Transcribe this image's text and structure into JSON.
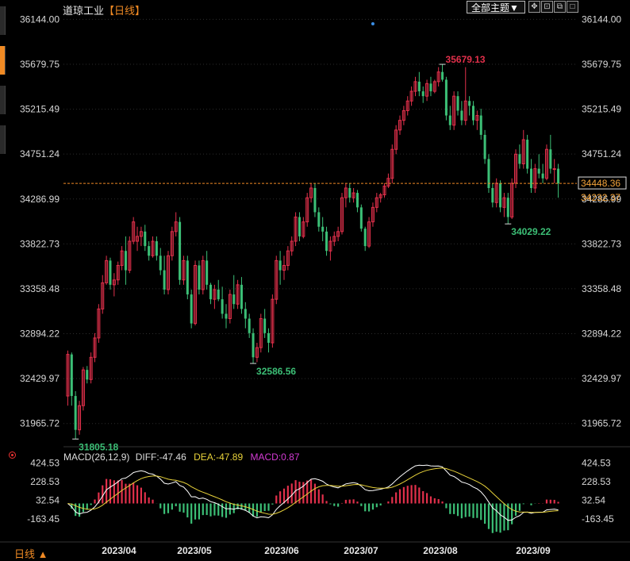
{
  "window": {
    "left_tabs": 4,
    "active_tab": 1
  },
  "title": {
    "name": "道琼工业",
    "period": "【日线】"
  },
  "toolbar": {
    "theme_label": "全部主题▼",
    "icons": [
      "move-icon",
      "zoom-fit-icon",
      "restore-icon",
      "maximize-icon"
    ]
  },
  "bottom": {
    "period_tab": "日线 ▲"
  },
  "colors": {
    "up": "#e2304b",
    "down": "#3cbf76",
    "diff": "#ffffff",
    "dea": "#e8d23a",
    "macd": "#d43bd4",
    "grid": "#2c2c2c",
    "current_line": "#f08a24"
  },
  "chart_data": [
    {
      "type": "candlestick",
      "title": "道琼工业",
      "y_ticks": [
        36144.0,
        35679.75,
        35215.49,
        34751.24,
        34286.99,
        33822.73,
        33358.48,
        32894.22,
        32429.97,
        31965.72
      ],
      "ylim": [
        31750,
        36180
      ],
      "x_ticks": [
        "2023/04",
        "2023/05",
        "2023/06",
        "2023/07",
        "2023/08",
        "2023/09"
      ],
      "current_price": "34448.36",
      "prev_close": "34232.37",
      "annotations": [
        {
          "label": "35679.13",
          "value": 35679.13,
          "type": "high"
        },
        {
          "label": "31805.18",
          "value": 31805.18,
          "type": "low"
        },
        {
          "label": "32586.56",
          "value": 32586.56,
          "type": "low"
        },
        {
          "label": "34029.22",
          "value": 34029.22,
          "type": "low"
        }
      ],
      "ohlc": [
        [
          32250,
          32720,
          32150,
          32680
        ],
        [
          32680,
          32700,
          32150,
          32250
        ],
        [
          32250,
          32300,
          31805,
          31900
        ],
        [
          31900,
          32200,
          31850,
          32150
        ],
        [
          32150,
          32550,
          32100,
          32520
        ],
        [
          32520,
          32560,
          32380,
          32420
        ],
        [
          32420,
          32700,
          32380,
          32650
        ],
        [
          32650,
          32900,
          32600,
          32850
        ],
        [
          32850,
          33200,
          32800,
          33150
        ],
        [
          33150,
          33500,
          33100,
          33420
        ],
        [
          33420,
          33700,
          33400,
          33650
        ],
        [
          33650,
          33680,
          33350,
          33400
        ],
        [
          33400,
          33520,
          33280,
          33450
        ],
        [
          33450,
          33640,
          33400,
          33600
        ],
        [
          33600,
          33800,
          33550,
          33750
        ],
        [
          33750,
          33900,
          33400,
          33550
        ],
        [
          33550,
          33900,
          33520,
          33850
        ],
        [
          33850,
          34100,
          33820,
          34050
        ],
        [
          33850,
          34000,
          33750,
          33900
        ],
        [
          33900,
          34000,
          33800,
          33950
        ],
        [
          33950,
          34020,
          33750,
          33800
        ],
        [
          33800,
          33850,
          33650,
          33700
        ],
        [
          33700,
          33900,
          33680,
          33850
        ],
        [
          33850,
          33900,
          33650,
          33700
        ],
        [
          33700,
          33780,
          33500,
          33550
        ],
        [
          33550,
          33700,
          33300,
          33350
        ],
        [
          33350,
          33750,
          33300,
          33700
        ],
        [
          33700,
          34000,
          33650,
          33950
        ],
        [
          33950,
          34150,
          33900,
          34050
        ],
        [
          34050,
          34100,
          33400,
          33450
        ],
        [
          33450,
          33700,
          33400,
          33650
        ],
        [
          33650,
          33700,
          33250,
          33300
        ],
        [
          33300,
          33350,
          32950,
          33000
        ],
        [
          33000,
          33650,
          32980,
          33600
        ],
        [
          33600,
          33650,
          33300,
          33350
        ],
        [
          33350,
          33700,
          33300,
          33650
        ],
        [
          33650,
          33750,
          33350,
          33400
        ],
        [
          33400,
          33420,
          33200,
          33250
        ],
        [
          33250,
          33400,
          33150,
          33350
        ],
        [
          33350,
          33450,
          33230,
          33250
        ],
        [
          33250,
          33380,
          33050,
          33100
        ],
        [
          33100,
          33200,
          32950,
          33050
        ],
        [
          33050,
          33350,
          33000,
          33300
        ],
        [
          33300,
          33500,
          33150,
          33200
        ],
        [
          33200,
          33450,
          33150,
          33400
        ],
        [
          33400,
          33480,
          33100,
          33150
        ],
        [
          33150,
          33220,
          32950,
          33050
        ],
        [
          33050,
          33100,
          32850,
          32900
        ],
        [
          32900,
          32950,
          32587,
          32650
        ],
        [
          32650,
          32800,
          32600,
          32750
        ],
        [
          32750,
          33100,
          32700,
          33050
        ],
        [
          33050,
          33150,
          32850,
          32900
        ],
        [
          32900,
          32950,
          32700,
          32800
        ],
        [
          32800,
          33300,
          32750,
          33250
        ],
        [
          33250,
          33700,
          33200,
          33650
        ],
        [
          33650,
          33750,
          33400,
          33550
        ],
        [
          33550,
          33700,
          33450,
          33600
        ],
        [
          33600,
          33800,
          33550,
          33750
        ],
        [
          33750,
          33900,
          33700,
          33850
        ],
        [
          33850,
          34150,
          33800,
          34100
        ],
        [
          34100,
          34150,
          33850,
          33900
        ],
        [
          33900,
          34100,
          33880,
          34050
        ],
        [
          34050,
          34350,
          34000,
          34300
        ],
        [
          34300,
          34450,
          34250,
          34400
        ],
        [
          34400,
          34450,
          34100,
          34150
        ],
        [
          34150,
          34200,
          33950,
          34000
        ],
        [
          34000,
          34100,
          33850,
          33950
        ],
        [
          33950,
          34000,
          33700,
          33750
        ],
        [
          33750,
          33900,
          33650,
          33850
        ],
        [
          33850,
          33950,
          33800,
          33900
        ],
        [
          33900,
          34000,
          33850,
          33950
        ],
        [
          33950,
          34350,
          33920,
          34300
        ],
        [
          34300,
          34450,
          34200,
          34400
        ],
        [
          34400,
          34450,
          34250,
          34300
        ],
        [
          34300,
          34400,
          34250,
          34350
        ],
        [
          34350,
          34380,
          34150,
          34200
        ],
        [
          34200,
          34230,
          33950,
          33980
        ],
        [
          33980,
          34000,
          33750,
          33800
        ],
        [
          33800,
          34100,
          33780,
          34050
        ],
        [
          34050,
          34250,
          34000,
          34200
        ],
        [
          34200,
          34350,
          34150,
          34300
        ],
        [
          34300,
          34350,
          34250,
          34330
        ],
        [
          34330,
          34450,
          34300,
          34420
        ],
        [
          34420,
          34550,
          34400,
          34500
        ],
        [
          34500,
          34850,
          34450,
          34800
        ],
        [
          34800,
          35050,
          34750,
          35000
        ],
        [
          35000,
          35150,
          34950,
          35100
        ],
        [
          35100,
          35250,
          35050,
          35200
        ],
        [
          35200,
          35350,
          35150,
          35300
        ],
        [
          35300,
          35450,
          35250,
          35400
        ],
        [
          35400,
          35550,
          35350,
          35500
        ],
        [
          35500,
          35600,
          35350,
          35400
        ],
        [
          35400,
          35450,
          35280,
          35350
        ],
        [
          35350,
          35520,
          35300,
          35480
        ],
        [
          35480,
          35550,
          35350,
          35400
        ],
        [
          35400,
          35520,
          35380,
          35500
        ],
        [
          35500,
          35650,
          35450,
          35600
        ],
        [
          35600,
          35679,
          35500,
          35520
        ],
        [
          35520,
          35550,
          35100,
          35150
        ],
        [
          35150,
          35250,
          35000,
          35050
        ],
        [
          35050,
          35400,
          35000,
          35350
        ],
        [
          35350,
          35400,
          35150,
          35200
        ],
        [
          35200,
          35300,
          35050,
          35100
        ],
        [
          35100,
          35650,
          35050,
          35300
        ],
        [
          35300,
          35350,
          35150,
          35250
        ],
        [
          35250,
          35300,
          35050,
          35100
        ],
        [
          35100,
          35200,
          35000,
          35150
        ],
        [
          35150,
          35220,
          34900,
          34950
        ],
        [
          34950,
          35000,
          34650,
          34700
        ],
        [
          34700,
          34750,
          34350,
          34400
        ],
        [
          34400,
          34450,
          34200,
          34250
        ],
        [
          34250,
          34500,
          34200,
          34450
        ],
        [
          34450,
          34480,
          34150,
          34200
        ],
        [
          34200,
          34350,
          34100,
          34300
        ],
        [
          34300,
          34350,
          34029,
          34100
        ],
        [
          34100,
          34500,
          34080,
          34450
        ],
        [
          34450,
          34800,
          34400,
          34750
        ],
        [
          34750,
          34850,
          34600,
          34650
        ],
        [
          34650,
          35000,
          34600,
          34900
        ],
        [
          34900,
          34950,
          34550,
          34600
        ],
        [
          34600,
          34700,
          34350,
          34400
        ],
        [
          34400,
          34650,
          34350,
          34600
        ],
        [
          34600,
          34750,
          34500,
          34550
        ],
        [
          34550,
          34650,
          34450,
          34500
        ],
        [
          34500,
          34850,
          34480,
          34800
        ],
        [
          34800,
          34950,
          34550,
          34600
        ],
        [
          34600,
          34700,
          34450,
          34600
        ],
        [
          34600,
          34650,
          34300,
          34448
        ]
      ]
    },
    {
      "type": "bar+line",
      "title": "MACD(26,12,9)",
      "legend": {
        "diff": "DIFF:-47.46",
        "dea": "DEA:-47.89",
        "macd": "MACD:0.87"
      },
      "y_ticks": [
        424.53,
        228.53,
        32.54,
        -163.45
      ],
      "ylim": [
        -380,
        430
      ]
    }
  ]
}
